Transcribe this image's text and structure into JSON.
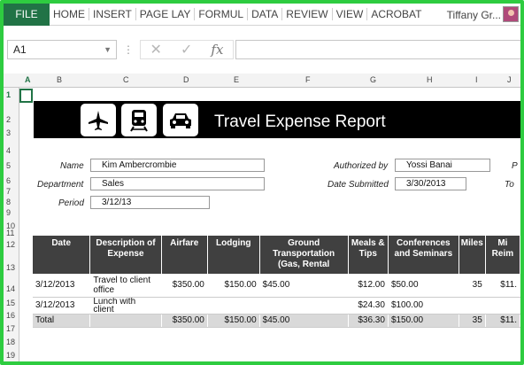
{
  "ribbon": {
    "tabs": [
      "FILE",
      "HOME",
      "INSERT",
      "PAGE LAY",
      "FORMUL",
      "DATA",
      "REVIEW",
      "VIEW",
      "ACROBAT"
    ],
    "user": "Tiffany Gr..."
  },
  "formula_bar": {
    "name_box": "A1",
    "cancel_glyph": "✕",
    "enter_glyph": "✓",
    "fx_label": "fx"
  },
  "grid": {
    "columns": [
      "A",
      "B",
      "C",
      "D",
      "E",
      "F",
      "G",
      "H",
      "I",
      "J"
    ],
    "rows": [
      "1",
      "2",
      "3",
      "4",
      "5",
      "6",
      "7",
      "8",
      "9",
      "10",
      "11",
      "12",
      "13",
      "14",
      "15",
      "16",
      "17",
      "18",
      "19"
    ]
  },
  "report": {
    "title": "Travel Expense Report",
    "icons": [
      "airplane-icon",
      "train-icon",
      "car-icon"
    ],
    "name_label": "Name",
    "name_value": "Kim Ambercrombie",
    "department_label": "Department",
    "department_value": "Sales",
    "period_label": "Period",
    "period_value": "3/12/13",
    "authorized_label": "Authorized by",
    "authorized_value": "Yossi Banai",
    "date_submitted_label": "Date Submitted",
    "date_submitted_value": "3/30/2013",
    "right_edge_1": "P",
    "right_edge_2": "To"
  },
  "table": {
    "headers": [
      "Date",
      "Description of Expense",
      "Airfare",
      "Lodging",
      "Ground Transportation (Gas, Rental",
      "Meals & Tips",
      "Conferences and Seminars",
      "Miles",
      "Mi Reim"
    ],
    "rows": [
      [
        "3/12/2013",
        "Travel to client office",
        "$350.00",
        "$150.00",
        "$45.00",
        "$12.00",
        "$50.00",
        "35",
        "$11."
      ],
      [
        "3/12/2013",
        "Lunch with client",
        "",
        "",
        "",
        "$24.30",
        "$100.00",
        "",
        ""
      ],
      [
        "Total",
        "",
        "$350.00",
        "$150.00",
        "$45.00",
        "$36.30",
        "$150.00",
        "35",
        "$11."
      ]
    ]
  },
  "colors": {
    "excel_green": "#217346",
    "frame_green": "#2ecc40",
    "banner_black": "#000000",
    "header_gray": "#404040",
    "total_gray": "#d9d9d9"
  }
}
